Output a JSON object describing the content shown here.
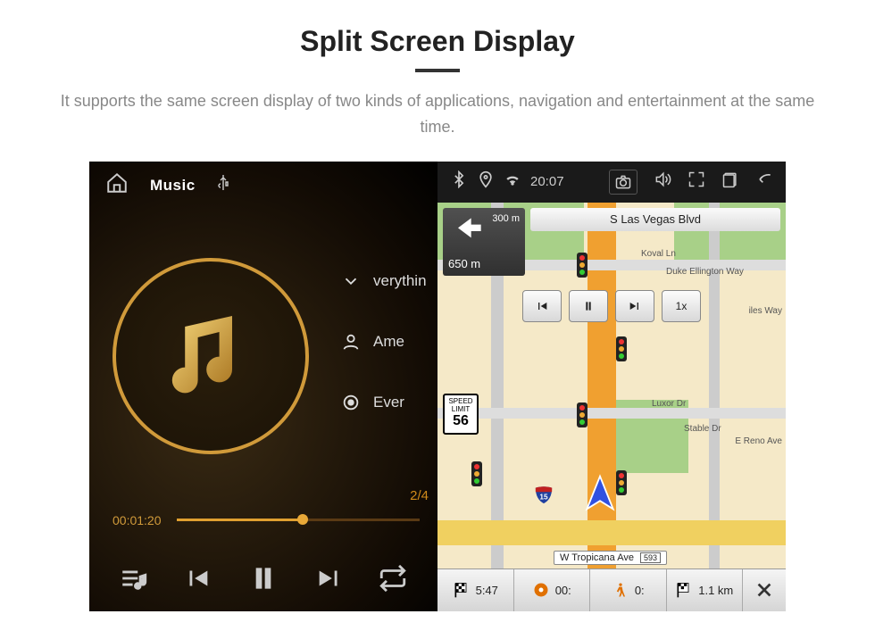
{
  "header": {
    "title": "Split Screen Display",
    "description": "It supports the same screen display of two kinds of applications, navigation and entertainment at the same time."
  },
  "music": {
    "app_label": "Music",
    "tracks": [
      {
        "icon": "down",
        "title": "verythin"
      },
      {
        "icon": "person",
        "title": "Ame"
      },
      {
        "icon": "record",
        "title": "Ever"
      }
    ],
    "counter": "2/4",
    "elapsed": "00:01:20",
    "progress_percent": 52
  },
  "nav": {
    "status": {
      "time": "20:07"
    },
    "turn": {
      "dist_small": "300 m",
      "dist_large": "650 m"
    },
    "street_banner": "S Las Vegas Blvd",
    "speed": {
      "label_top": "SPEED",
      "label_mid": "LIMIT",
      "value": "56"
    },
    "sim": {
      "speed_label": "1x"
    },
    "roads": {
      "koval": "Koval Ln",
      "ellington": "Duke Ellington Way",
      "luxor": "Luxor Dr",
      "stable": "Stable Dr",
      "reno": "E Reno Ave",
      "riles": "iles Way",
      "tropicana": "W Tropicana Ave",
      "tropicana_badge": "593"
    },
    "bottom": {
      "eta": "5:47",
      "disc": "00:",
      "walk": "0:",
      "dist": "1.1 km"
    }
  }
}
